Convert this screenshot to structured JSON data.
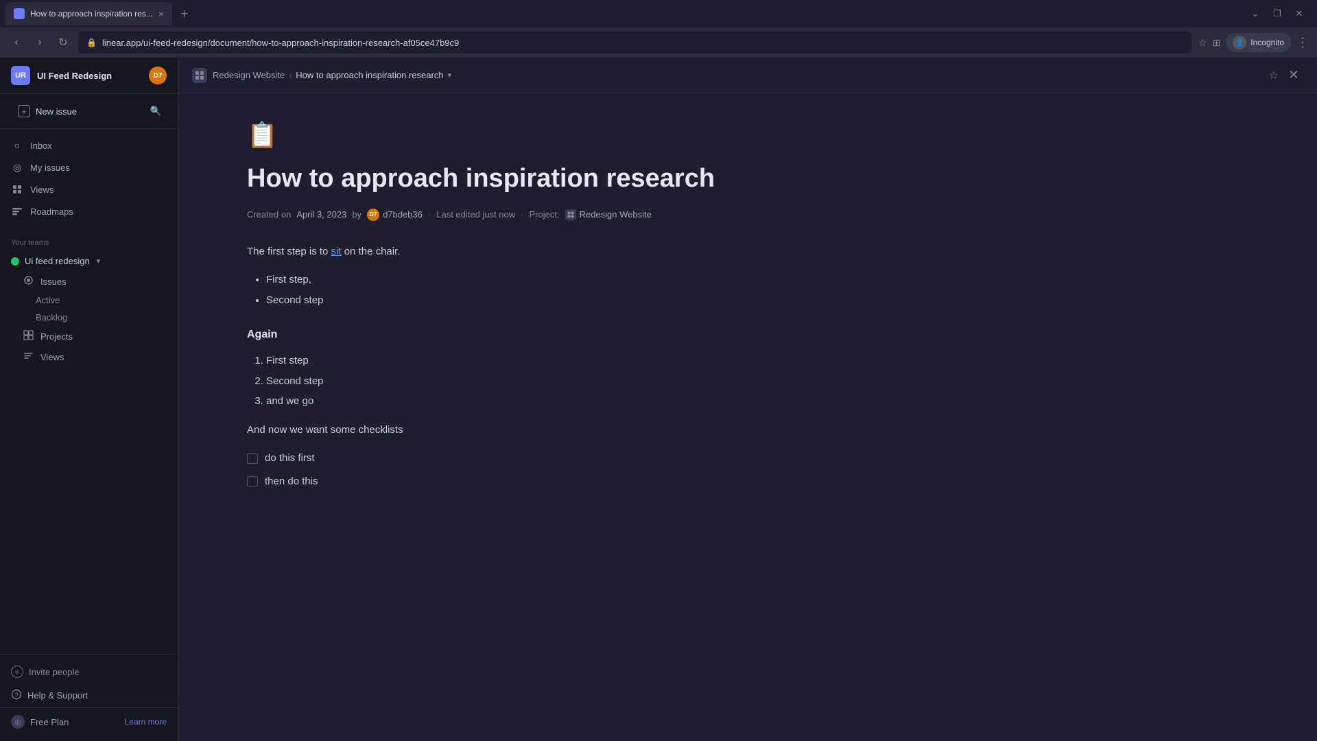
{
  "browser": {
    "tab_title": "How to approach inspiration res...",
    "tab_close": "×",
    "tab_new": "+",
    "url": "linear.app/ui-feed-redesign/document/how-to-approach-inspiration-research-af05ce47b9c9",
    "window_controls": {
      "minimize": "⌄",
      "maximize": "❐",
      "close": "✕"
    },
    "incognito_label": "Incognito",
    "nav_back": "‹",
    "nav_forward": "›",
    "nav_refresh": "↻",
    "star_icon": "☆",
    "extensions_icon": "⊞",
    "more_icon": "⋮"
  },
  "sidebar": {
    "workspace_initials": "UR",
    "workspace_name": "UI Feed Redesign",
    "user_initials": "D7",
    "new_issue_label": "New issue",
    "nav_items": [
      {
        "id": "inbox",
        "label": "Inbox",
        "icon": "○"
      },
      {
        "id": "my-issues",
        "label": "My issues",
        "icon": "◎"
      },
      {
        "id": "views",
        "label": "Views",
        "icon": "◈"
      },
      {
        "id": "roadmaps",
        "label": "Roadmaps",
        "icon": "⊞"
      }
    ],
    "your_teams_label": "Your teams",
    "team": {
      "name": "Ui feed redesign",
      "items": [
        {
          "id": "issues",
          "label": "Issues",
          "icon": "○"
        },
        {
          "id": "projects",
          "label": "Projects",
          "icon": "⊞"
        },
        {
          "id": "views",
          "label": "Views",
          "icon": "◈"
        }
      ],
      "sub_items": [
        {
          "id": "active",
          "label": "Active"
        },
        {
          "id": "backlog",
          "label": "Backlog"
        }
      ]
    },
    "invite_label": "Invite people",
    "help_label": "Help & Support",
    "free_plan_label": "Free Plan",
    "learn_more_label": "Learn more"
  },
  "doc_header": {
    "icon": "⊞",
    "breadcrumb_parent": "Redesign Website",
    "breadcrumb_sep": "›",
    "breadcrumb_current": "How to approach inspiration research",
    "star_icon": "☆",
    "close_icon": "✕"
  },
  "document": {
    "emoji": "📋",
    "title": "How to approach inspiration research",
    "meta": {
      "created_prefix": "Created on",
      "date": "April 3, 2023",
      "by": "by",
      "author_initials": "D7",
      "author_name": "d7bdeb36",
      "separator1": "·",
      "edited": "Last edited just now",
      "separator2": "·",
      "project_prefix": "Project:",
      "project_icon": "⊞",
      "project_name": "Redesign Website"
    },
    "content": {
      "paragraph1_pre": "The first step is to ",
      "paragraph1_link": "sit",
      "paragraph1_post": " on the chair.",
      "bullet_list": [
        "First step,",
        "Second step"
      ],
      "heading1": "Again",
      "ordered_list": [
        "First step",
        "Second step",
        "and we go"
      ],
      "heading2": "And now we want some checklists",
      "checklist": [
        {
          "label": "do this first",
          "checked": false
        },
        {
          "label": "then do this",
          "checked": false
        }
      ]
    }
  }
}
